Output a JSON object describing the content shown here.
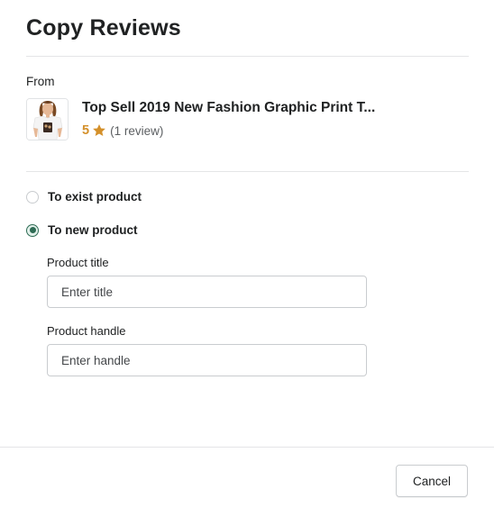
{
  "modal": {
    "title": "Copy Reviews",
    "from_label": "From",
    "product": {
      "name": "Top Sell 2019 New Fashion Graphic Print T...",
      "rating": "5",
      "review_count": "(1 review)"
    },
    "options": [
      {
        "label": "To exist product",
        "checked": false
      },
      {
        "label": "To new product",
        "checked": true
      }
    ],
    "fields": {
      "title": {
        "label": "Product title",
        "placeholder": "Enter title",
        "value": ""
      },
      "handle": {
        "label": "Product handle",
        "placeholder": "Enter handle",
        "value": ""
      }
    },
    "footer": {
      "cancel_label": "Cancel"
    }
  },
  "colors": {
    "accent": "#2e6b54",
    "star": "#d4902a",
    "border": "#c9cccf",
    "divider": "#e4e5e7"
  },
  "icons": {
    "rating": "star-icon",
    "thumbnail": "product-thumbnail"
  }
}
